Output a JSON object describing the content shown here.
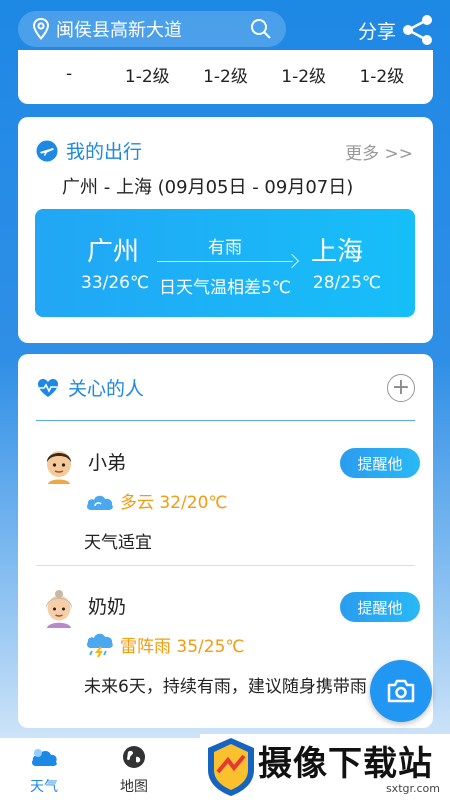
{
  "header": {
    "location": "闽侯县高新大道",
    "share_label": "分享"
  },
  "wind_levels": [
    "-",
    "1-2级",
    "1-2级",
    "1-2级",
    "1-2级"
  ],
  "trip": {
    "title": "我的出行",
    "more": "更多 >>",
    "route": "广州 - 上海 (09月05日 - 09月07日)",
    "from_city": "广州",
    "to_city": "上海",
    "condition": "有雨",
    "from_temp": "33/26℃",
    "to_temp": "28/25℃",
    "temp_diff": "日天气温相差5℃"
  },
  "care": {
    "title": "关心的人",
    "add_label": "+",
    "people": [
      {
        "name": "小弟",
        "remind": "提醒他",
        "weather": "多云 32/20℃",
        "advice": "天气适宜"
      },
      {
        "name": "奶奶",
        "remind": "提醒他",
        "weather": "雷阵雨 35/25℃",
        "advice": "未来6天，持续有雨，建议随身携带雨"
      }
    ]
  },
  "nav": {
    "weather_label": "天气",
    "map_label": "地图"
  },
  "watermark": {
    "text": "摄像下载站",
    "url": "sxtgr.com"
  },
  "colors": {
    "accent": "#1e88e5",
    "warm_text": "#f39c12",
    "trip_box": "#1bb3f6"
  }
}
